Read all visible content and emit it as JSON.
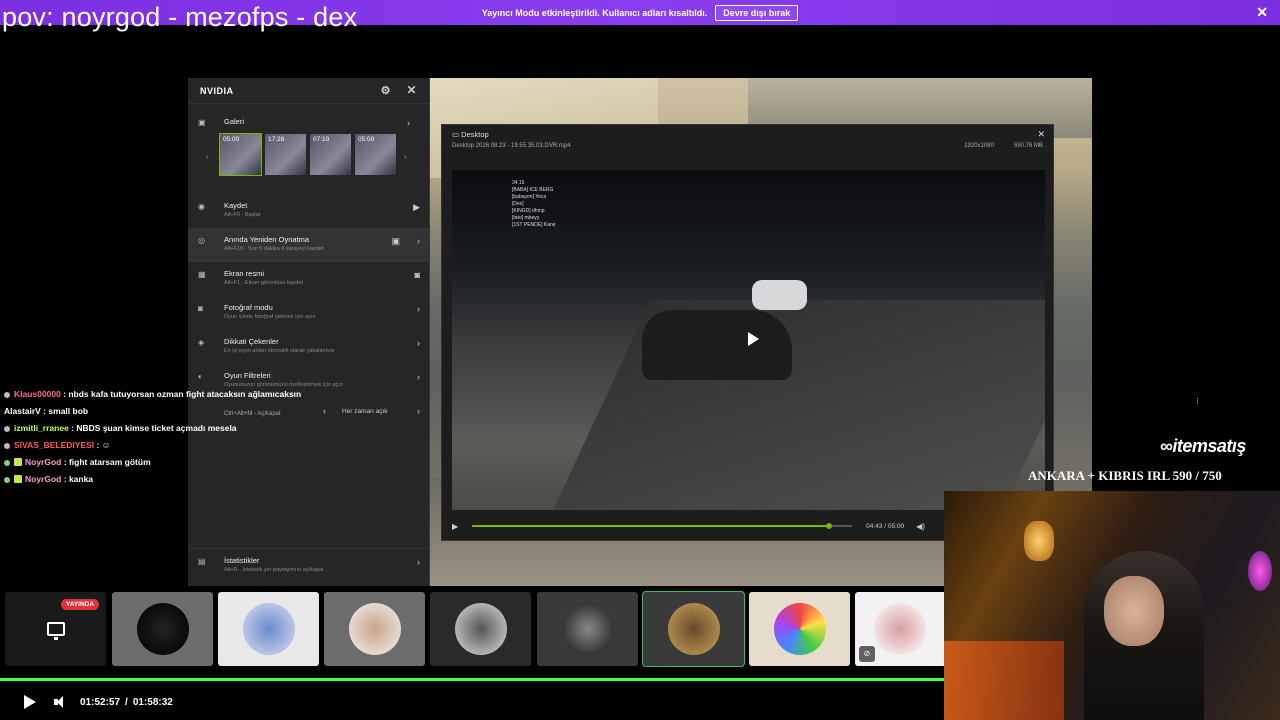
{
  "banner": {
    "message": "Yayıncı Modu etkinleştirildi. Kullanıcı adları kısaltıldı.",
    "disable_label": "Devre dışı bırak",
    "close_icon": "close-icon"
  },
  "stream_title": "pov: noyrgod - mezofps - dex",
  "nvidia": {
    "title": "NVIDIA",
    "gallery_label": "Galeri",
    "thumbnails": [
      "05:00",
      "17:28",
      "07:10",
      "05:00"
    ],
    "items": [
      {
        "title": "Kaydet",
        "subtitle": "Alt+F9 - Başlat",
        "icon": "record-icon"
      },
      {
        "title": "Anında Yeniden Oynatma",
        "subtitle": "Alt+F10 - Son 5 dakika 0 saniyeyi kaydet",
        "icon": "replay-icon"
      },
      {
        "title": "Ekran resmi",
        "subtitle": "Alt+F1 - Ekran görüntüsü kaydet",
        "icon": "screenshot-icon"
      },
      {
        "title": "Fotoğraf modu",
        "subtitle": "Oyun içinde fotoğraf çekmek için açın",
        "icon": "camera-icon"
      },
      {
        "title": "Dikkati Çekenler",
        "subtitle": "En iyi oyun anları otomatik olarak yakalanıyor",
        "icon": "highlights-icon"
      },
      {
        "title": "Oyun Filtreleri",
        "subtitle": "Oyununuzun görünümünü özelleştirmek için açın",
        "icon": "filter-icon"
      }
    ],
    "overlay_shortcut": "Ctrl+Alt+M - Aç/kapat",
    "overlay_option": "Her zaman açık",
    "stats_title": "İstatistikler",
    "stats_subtitle": "Alt+R - İstatistik yer paylaşımını aç/kapat"
  },
  "clip": {
    "window_title": "Desktop",
    "filename": "Desktop 2026.08.23 - 19.55.35.03.DVR.mp4",
    "resolution": "1920x1080",
    "size": "590.76 MB",
    "time": "04:43 / 05:00",
    "progress": 0.94,
    "hud_lines": [
      "34.15",
      "[BABA] ICE BERG",
      "[babayım] Yeca",
      "[Dex]",
      "[KINGD] dhmp",
      "[tato] mbeyy",
      "[1ST PENDE] Kane"
    ]
  },
  "chat": [
    {
      "user": "Klaus00000",
      "text": "nbds kafa tutuyorsan ozman fight atacaksın ağlamıcaksın",
      "color": "#ff6b8a",
      "badge": "grey"
    },
    {
      "user": "AlastairV",
      "text": "small bob",
      "color": "#ffffff",
      "badge": "none"
    },
    {
      "user": "izmitli_rranee",
      "text": "NBDS şuan kimse ticket açmadı mesela",
      "color": "#c8ff3c",
      "badge": "grey"
    },
    {
      "user": "SIVAS_BELEDIYESI",
      "text": "",
      "color": "#ff5a5a",
      "badge": "grey"
    },
    {
      "user": "NoyrGod",
      "text": "fight atarsam götüm",
      "color": "#ff9ad0",
      "badge": "green"
    },
    {
      "user": "NoyrGod",
      "text": "kanka",
      "color": "#ff9ad0",
      "badge": "green"
    }
  ],
  "brand": "itemsatış",
  "promo": "ANKARA + KIBRIS IRL 590 / 750",
  "participants": {
    "live_label": "YAYINDA",
    "tiles": [
      "screen-share",
      "user-1",
      "user-2",
      "user-3",
      "user-4",
      "user-5",
      "user-6",
      "user-7",
      "user-8"
    ]
  },
  "player": {
    "current": "01:52:57",
    "separator": "/",
    "total": "01:58:32",
    "progress_color": "#44ff44"
  }
}
